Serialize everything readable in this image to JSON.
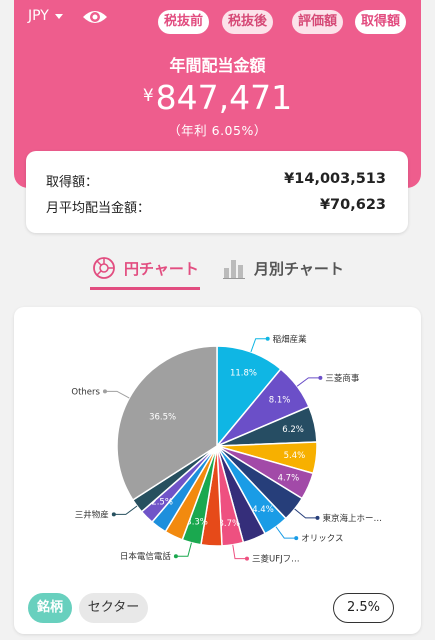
{
  "currency": "JPY",
  "tax_toggle": [
    "税抜前",
    "税抜後"
  ],
  "value_toggle": [
    "評価額",
    "取得額"
  ],
  "summary": {
    "title": "年間配当金額",
    "yen": "¥",
    "amount": "847,471",
    "yield": "（年利 6.05%）"
  },
  "info": {
    "acq_label": "取得額：",
    "acq_value": "¥14,003,513",
    "monthly_label": "月平均配当金額：",
    "monthly_value": "¥70,623"
  },
  "tabs": {
    "pie": "円チャート",
    "monthly": "月別チャート"
  },
  "chart_data": {
    "type": "pie",
    "slices": [
      {
        "name": "稲畑産業",
        "value": 11.8,
        "label": "11.8%",
        "color": "#0fb6e4"
      },
      {
        "name": "三菱商事",
        "value": 8.1,
        "label": "8.1%",
        "color": "#6b4fc8"
      },
      {
        "name": "",
        "value": 6.2,
        "label": "6.2%",
        "color": "#264d63"
      },
      {
        "name": "",
        "value": 5.4,
        "label": "5.4%",
        "color": "#f7b000"
      },
      {
        "name": "",
        "value": 4.7,
        "label": "4.7%",
        "color": "#a24aa8"
      },
      {
        "name": "東京海上ホー…",
        "value": 4.4,
        "label": "",
        "color": "#263e7a"
      },
      {
        "name": "オリックス",
        "value": 4.4,
        "label": "4.4%",
        "color": "#1a9ce6"
      },
      {
        "name": "",
        "value": 4.0,
        "label": "",
        "color": "#352e7a"
      },
      {
        "name": "三菱UFJフ…",
        "value": 3.7,
        "label": "3.7%",
        "color": "#ee5080"
      },
      {
        "name": "",
        "value": 3.6,
        "label": "",
        "color": "#e64a19"
      },
      {
        "name": "日本電信電話",
        "value": 3.3,
        "label": "3.3%",
        "color": "#1aa84f"
      },
      {
        "name": "",
        "value": 3.2,
        "label": "",
        "color": "#f28a0f"
      },
      {
        "name": "",
        "value": 2.8,
        "label": "",
        "color": "#1d8fdc"
      },
      {
        "name": "",
        "value": 2.5,
        "label": "2.5%",
        "color": "#7054c8"
      },
      {
        "name": "三井物産",
        "value": 2.5,
        "label": "",
        "color": "#27505f"
      },
      {
        "name": "Others",
        "value": 36.5,
        "label": "36.5%",
        "color": "#a0a0a0"
      }
    ]
  },
  "buttons": {
    "stock": "銘柄",
    "sector": "セクター",
    "threshold": "2.5%"
  }
}
